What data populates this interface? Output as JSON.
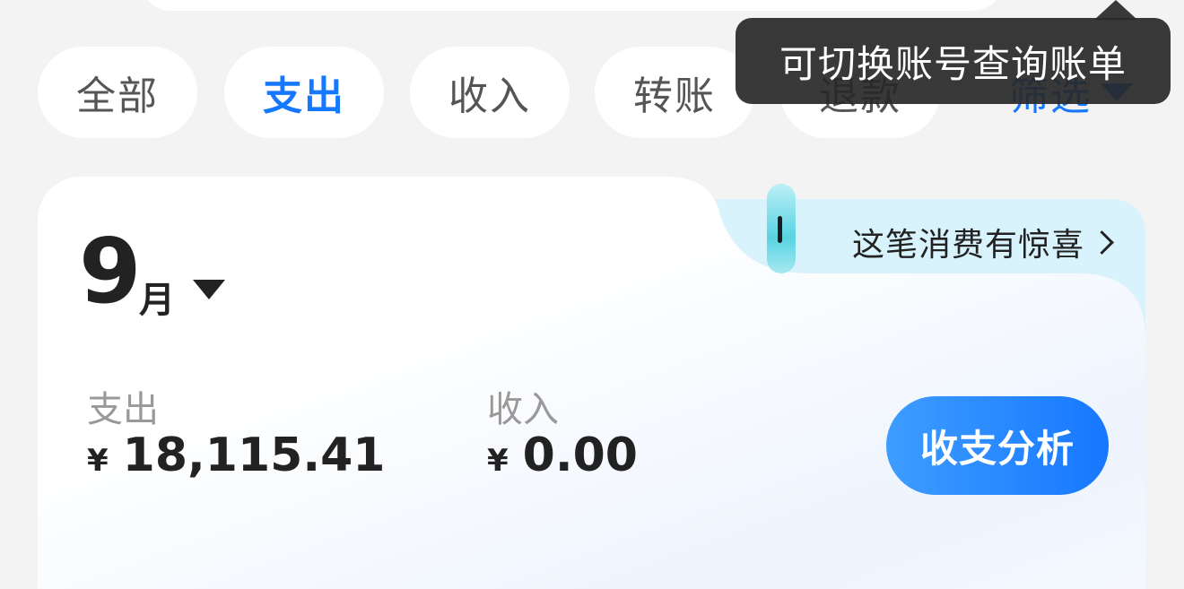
{
  "tabs": [
    {
      "label": "全部",
      "active": false
    },
    {
      "label": "支出",
      "active": true
    },
    {
      "label": "收入",
      "active": false
    },
    {
      "label": "转账",
      "active": false
    },
    {
      "label": "退款",
      "active": false
    }
  ],
  "filter": {
    "label": "筛选"
  },
  "tooltip": {
    "text": "可切换账号查询账单"
  },
  "promo": {
    "text": "这笔消费有惊喜"
  },
  "summary": {
    "month": "9",
    "month_unit": "月",
    "expense": {
      "label": "支出",
      "currency": "¥",
      "amount": "18,115.41"
    },
    "income": {
      "label": "收入",
      "currency": "¥",
      "amount": "0.00"
    },
    "analysis_button": "收支分析"
  },
  "colors": {
    "accent": "#1677ff",
    "promo_bg": "#d9f3fd",
    "tooltip_bg": "#282828"
  }
}
